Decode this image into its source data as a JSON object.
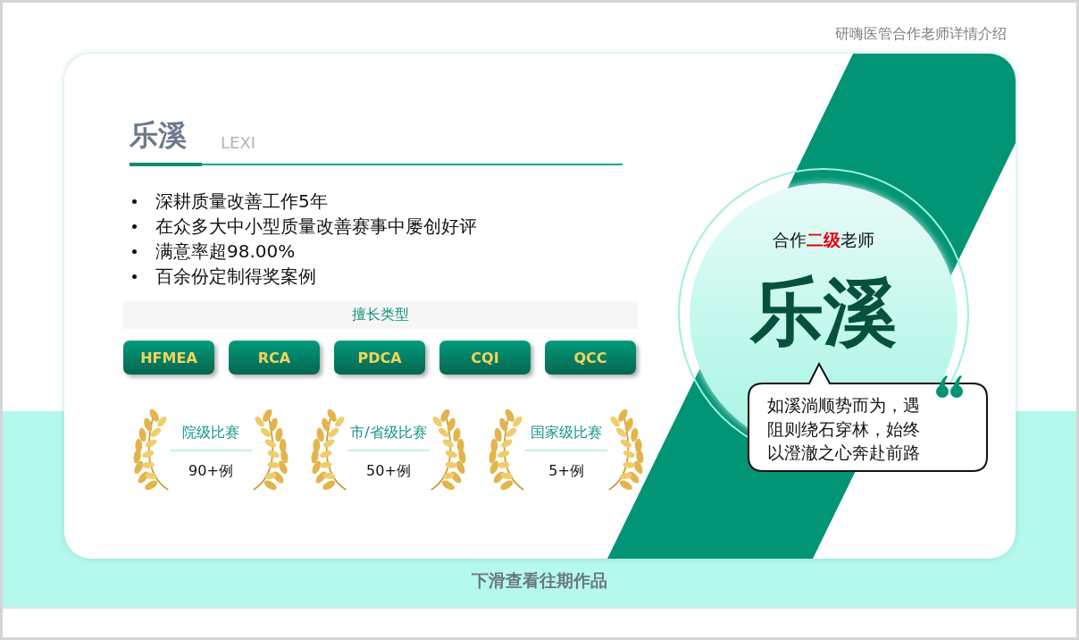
{
  "header": {
    "title": "研嗨医管合作老师详情介绍"
  },
  "profile": {
    "name": "乐溪",
    "name_en": "LEXI",
    "bullets": [
      "深耕质量改善工作5年",
      "在众多大中小型质量改善赛事中屡创好评",
      "满意率超98.00%",
      "百余份定制得奖案例"
    ],
    "skills_title": "擅长类型",
    "skills": [
      "HFMEA",
      "RCA",
      "PDCA",
      "CQI",
      "QCC"
    ],
    "awards": [
      {
        "title": "院级比赛",
        "count": "90+例"
      },
      {
        "title": "市/省级比赛",
        "count": "50+例"
      },
      {
        "title": "国家级比赛",
        "count": "5+例"
      }
    ]
  },
  "badge": {
    "rank": "合作**二级**老师",
    "name": "乐溪",
    "quote": "如溪淌顺势而为，遇阻则绕石穿林，始终以澄澈之心奔赴前路"
  },
  "footer": {
    "hint": "下滑查看往期作品"
  }
}
